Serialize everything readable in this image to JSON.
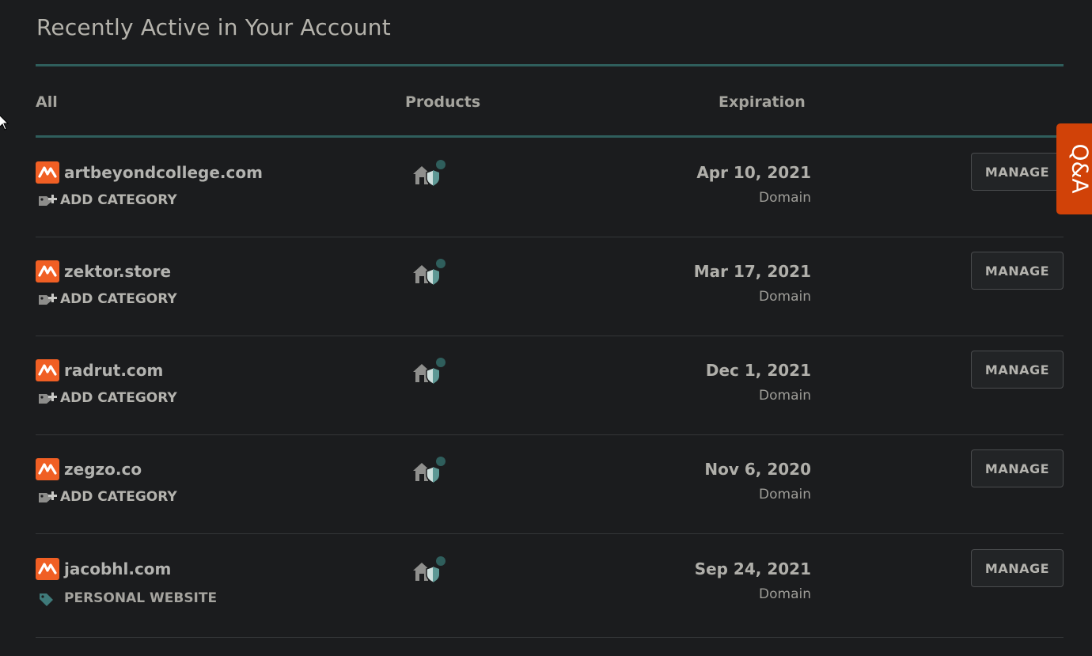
{
  "section_title": "Recently Active in Your Account",
  "columns": {
    "all": "All",
    "products": "Products",
    "expiration": "Expiration"
  },
  "rows": [
    {
      "domain": "artbeyondcollege.com",
      "category": "ADD CATEGORY",
      "category_type": "add",
      "expiration": "Apr 10, 2021",
      "type": "Domain",
      "action": "MANAGE"
    },
    {
      "domain": "zektor.store",
      "category": "ADD CATEGORY",
      "category_type": "add",
      "expiration": "Mar 17, 2021",
      "type": "Domain",
      "action": "MANAGE"
    },
    {
      "domain": "radrut.com",
      "category": "ADD CATEGORY",
      "category_type": "add",
      "expiration": "Dec 1, 2021",
      "type": "Domain",
      "action": "MANAGE"
    },
    {
      "domain": "zegzo.co",
      "category": "ADD CATEGORY",
      "category_type": "add",
      "expiration": "Nov 6, 2020",
      "type": "Domain",
      "action": "MANAGE"
    },
    {
      "domain": "jacobhl.com",
      "category": "PERSONAL WEBSITE",
      "category_type": "tag",
      "expiration": "Sep 24, 2021",
      "type": "Domain",
      "action": "MANAGE"
    }
  ],
  "feedback_tab": {
    "label": "Q&A"
  },
  "icons": {
    "brand": "namecheap-logo-icon",
    "add_category": "tag-add-icon",
    "category_tag": "tag-icon",
    "product": "house-shield-icon"
  },
  "colors": {
    "background": "#1b1c1e",
    "accent_rule": "#2f5e5c",
    "brand_orange": "#f05f24",
    "feedback_tab": "#d14208",
    "tag_teal": "#3f7a7a"
  }
}
